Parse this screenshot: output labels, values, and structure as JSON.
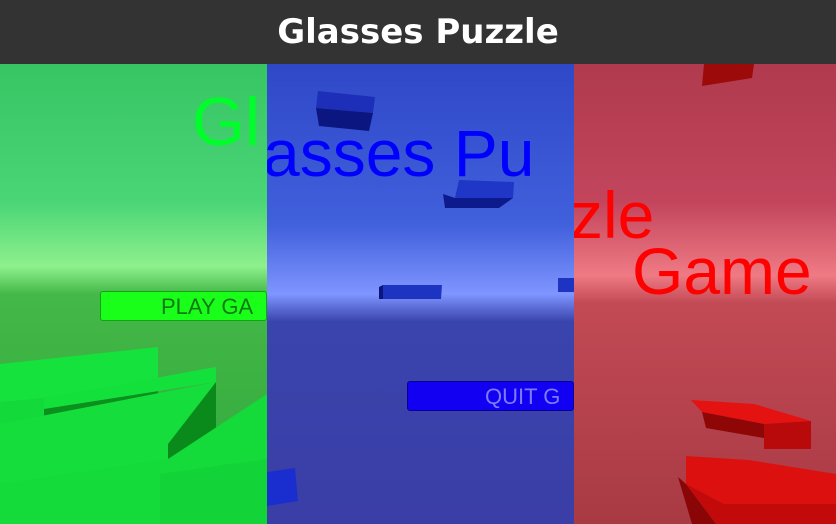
{
  "window": {
    "title": "Glasses Puzzle"
  },
  "panels": {
    "green": {
      "title_fragment": "Gl",
      "button_label": "PLAY GA",
      "tint": "#00ff2a"
    },
    "blue": {
      "title_fragment": "asses Pu",
      "button_label": "QUIT G",
      "tint": "#0000ff"
    },
    "red": {
      "title_fragment_1": "zle",
      "title_fragment_2": "Game",
      "tint": "#ff0000"
    }
  }
}
